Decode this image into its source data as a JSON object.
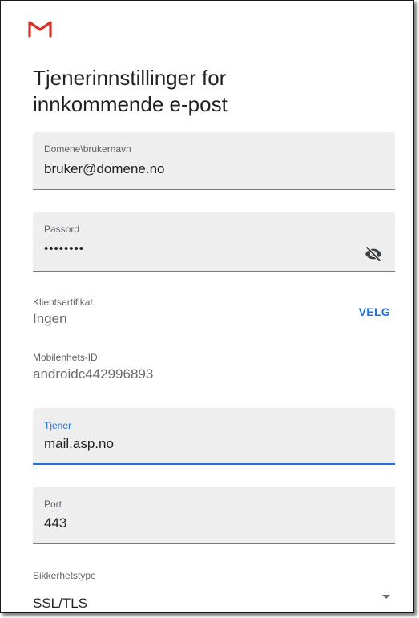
{
  "header": {
    "logo_icon": "gmail-m-icon",
    "title_line1": "Tjenerinnstillinger for",
    "title_line2": "innkommende e-post"
  },
  "fields": {
    "username": {
      "label": "Domene\\brukernavn",
      "value": "bruker@domene.no"
    },
    "password": {
      "label": "Passord",
      "value": "••••••••",
      "toggle_icon": "eye-off-icon"
    },
    "client_cert": {
      "label": "Klientsertifikat",
      "value": "Ingen",
      "action": "VELG"
    },
    "device_id": {
      "label": "Mobilenhets-ID",
      "value": "androidc442996893"
    },
    "server": {
      "label": "Tjener",
      "value": "mail.asp.no"
    },
    "port": {
      "label": "Port",
      "value": "443"
    },
    "security": {
      "label": "Sikkerhetstype",
      "value": "SSL/TLS",
      "dropdown_icon": "caret-down-icon"
    }
  },
  "colors": {
    "accent": "#1a73e8",
    "field_bg": "#eeeeee",
    "logo_red": "#d93025"
  }
}
